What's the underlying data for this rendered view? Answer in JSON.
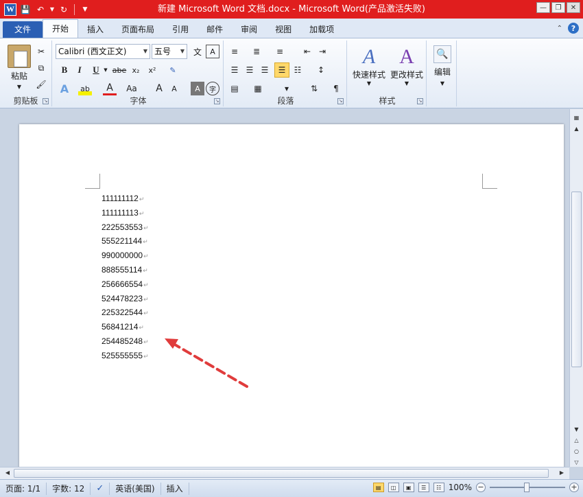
{
  "window": {
    "title": "新建 Microsoft Word 文档.docx - Microsoft Word(产品激活失败)",
    "logo": "W",
    "controls": [
      "minimize-icon",
      "restore-icon",
      "close-icon"
    ]
  },
  "qat": {
    "icons": [
      "word-logo-icon",
      "save-icon",
      "undo-icon",
      "redo-icon",
      "customize-qat-icon"
    ]
  },
  "tabs": [
    {
      "label": "文件",
      "type": "file"
    },
    {
      "label": "开始",
      "type": "active"
    },
    {
      "label": "插入",
      "type": "normal"
    },
    {
      "label": "页面布局",
      "type": "normal"
    },
    {
      "label": "引用",
      "type": "normal"
    },
    {
      "label": "邮件",
      "type": "normal"
    },
    {
      "label": "审阅",
      "type": "normal"
    },
    {
      "label": "视图",
      "type": "normal"
    },
    {
      "label": "加载项",
      "type": "normal"
    }
  ],
  "ribbon": {
    "clipboard": {
      "label": "剪贴板",
      "paste": "粘贴"
    },
    "font": {
      "label": "字体",
      "font_name": "Calibri (西文正文)",
      "font_size": "五号",
      "bold": "B",
      "italic": "I",
      "underline": "U",
      "strike": "abe",
      "subscript": "x₂",
      "superscript": "x²",
      "change_case": "Aa",
      "grow": "A",
      "shrink": "A",
      "text_color": "A",
      "highlight": "ab"
    },
    "paragraph": {
      "label": "段落"
    },
    "styles": {
      "label": "样式",
      "quick_styles": "快速样式",
      "change_styles": "更改样式"
    },
    "editing": {
      "label": "编辑"
    }
  },
  "document": {
    "lines": [
      "111111112",
      "111111113",
      "222553553",
      "555221144",
      "990000000",
      "888555114",
      "256666554",
      "524478223",
      "225322544",
      "56841214",
      "254485248",
      "525555555"
    ],
    "paragraph_mark": "↵"
  },
  "status": {
    "page": "页面: 1/1",
    "words": "字数: 12",
    "language": "英语(美国)",
    "mode": "插入",
    "zoom": "100%",
    "zoom_level": 1.0
  },
  "colors": {
    "titlebar": "#e01e1e",
    "file_tab": "#2b5fb4",
    "arrow": "#e03c3c"
  }
}
